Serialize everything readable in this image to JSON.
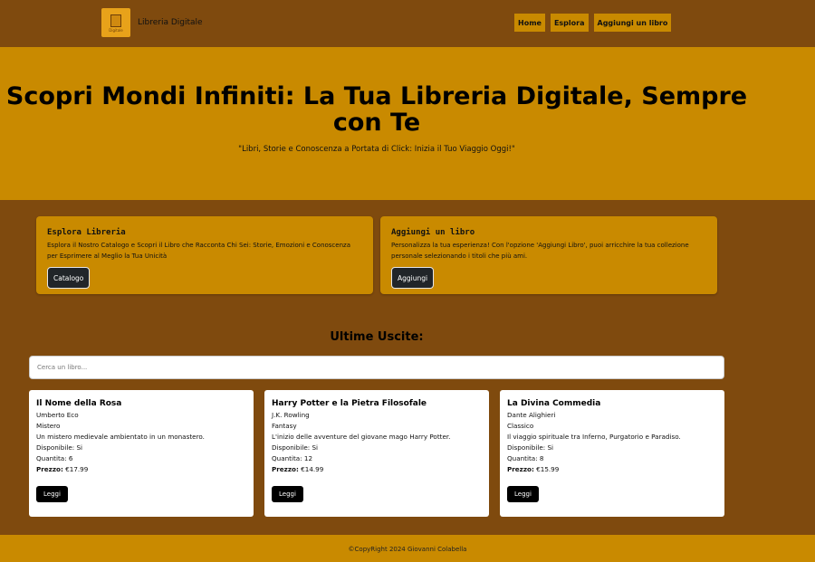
{
  "brand": {
    "name": "Libreria Digitale",
    "logo_text": "Digitale"
  },
  "nav": {
    "items": [
      "Home",
      "Esplora",
      "Aggiungi un libro"
    ]
  },
  "hero": {
    "title": "Scopri Mondi Infiniti: La Tua Libreria Digitale, Sempre con Te",
    "subtitle": "\"Libri, Storie e Conoscenza a Portata di Click: Inizia il Tuo Viaggio Oggi!\""
  },
  "features": [
    {
      "title": "Esplora Libreria",
      "description": "Esplora il Nostro Catalogo e Scopri il Libro che Racconta Chi Sei: Storie, Emozioni e Conoscenza per Esprimere al Meglio la Tua Unicità",
      "button": "Catalogo"
    },
    {
      "title": "Aggiungi un libro",
      "description": "Personalizza la tua esperienza! Con l'opzione 'Aggiungi Libro', puoi arricchire la tua collezione personale selezionando i titoli che più ami.",
      "button": "Aggiungi"
    }
  ],
  "latest": {
    "title": "Ultime Uscite:",
    "search_placeholder": "Cerca un libro...",
    "books": [
      {
        "title": "Il Nome della Rosa",
        "author": "Umberto Eco",
        "genre": "Mistero",
        "description": "Un mistero medievale ambientato in un monastero.",
        "available": "Disponibile: Si",
        "quantity": "Quantita: 6",
        "price_label": "Prezzo:",
        "price": "€17.99",
        "button": "Leggi"
      },
      {
        "title": "Harry Potter e la Pietra Filosofale",
        "author": "J.K. Rowling",
        "genre": "Fantasy",
        "description": "L'inizio delle avventure del giovane mago Harry Potter.",
        "available": "Disponibile: Si",
        "quantity": "Quantita: 12",
        "price_label": "Prezzo:",
        "price": "€14.99",
        "button": "Leggi"
      },
      {
        "title": "La Divina Commedia",
        "author": "Dante Alighieri",
        "genre": "Classico",
        "description": "Il viaggio spirituale tra Inferno, Purgatorio e Paradiso.",
        "available": "Disponibile: Si",
        "quantity": "Quantita: 8",
        "price_label": "Prezzo:",
        "price": "€15.99",
        "button": "Leggi"
      }
    ]
  },
  "footer": {
    "text": "©CopyRight 2024 Giovanni Colabella"
  },
  "colors": {
    "background": "#7f4a0e",
    "accent": "#c98a00",
    "button_dark": "#212529"
  }
}
